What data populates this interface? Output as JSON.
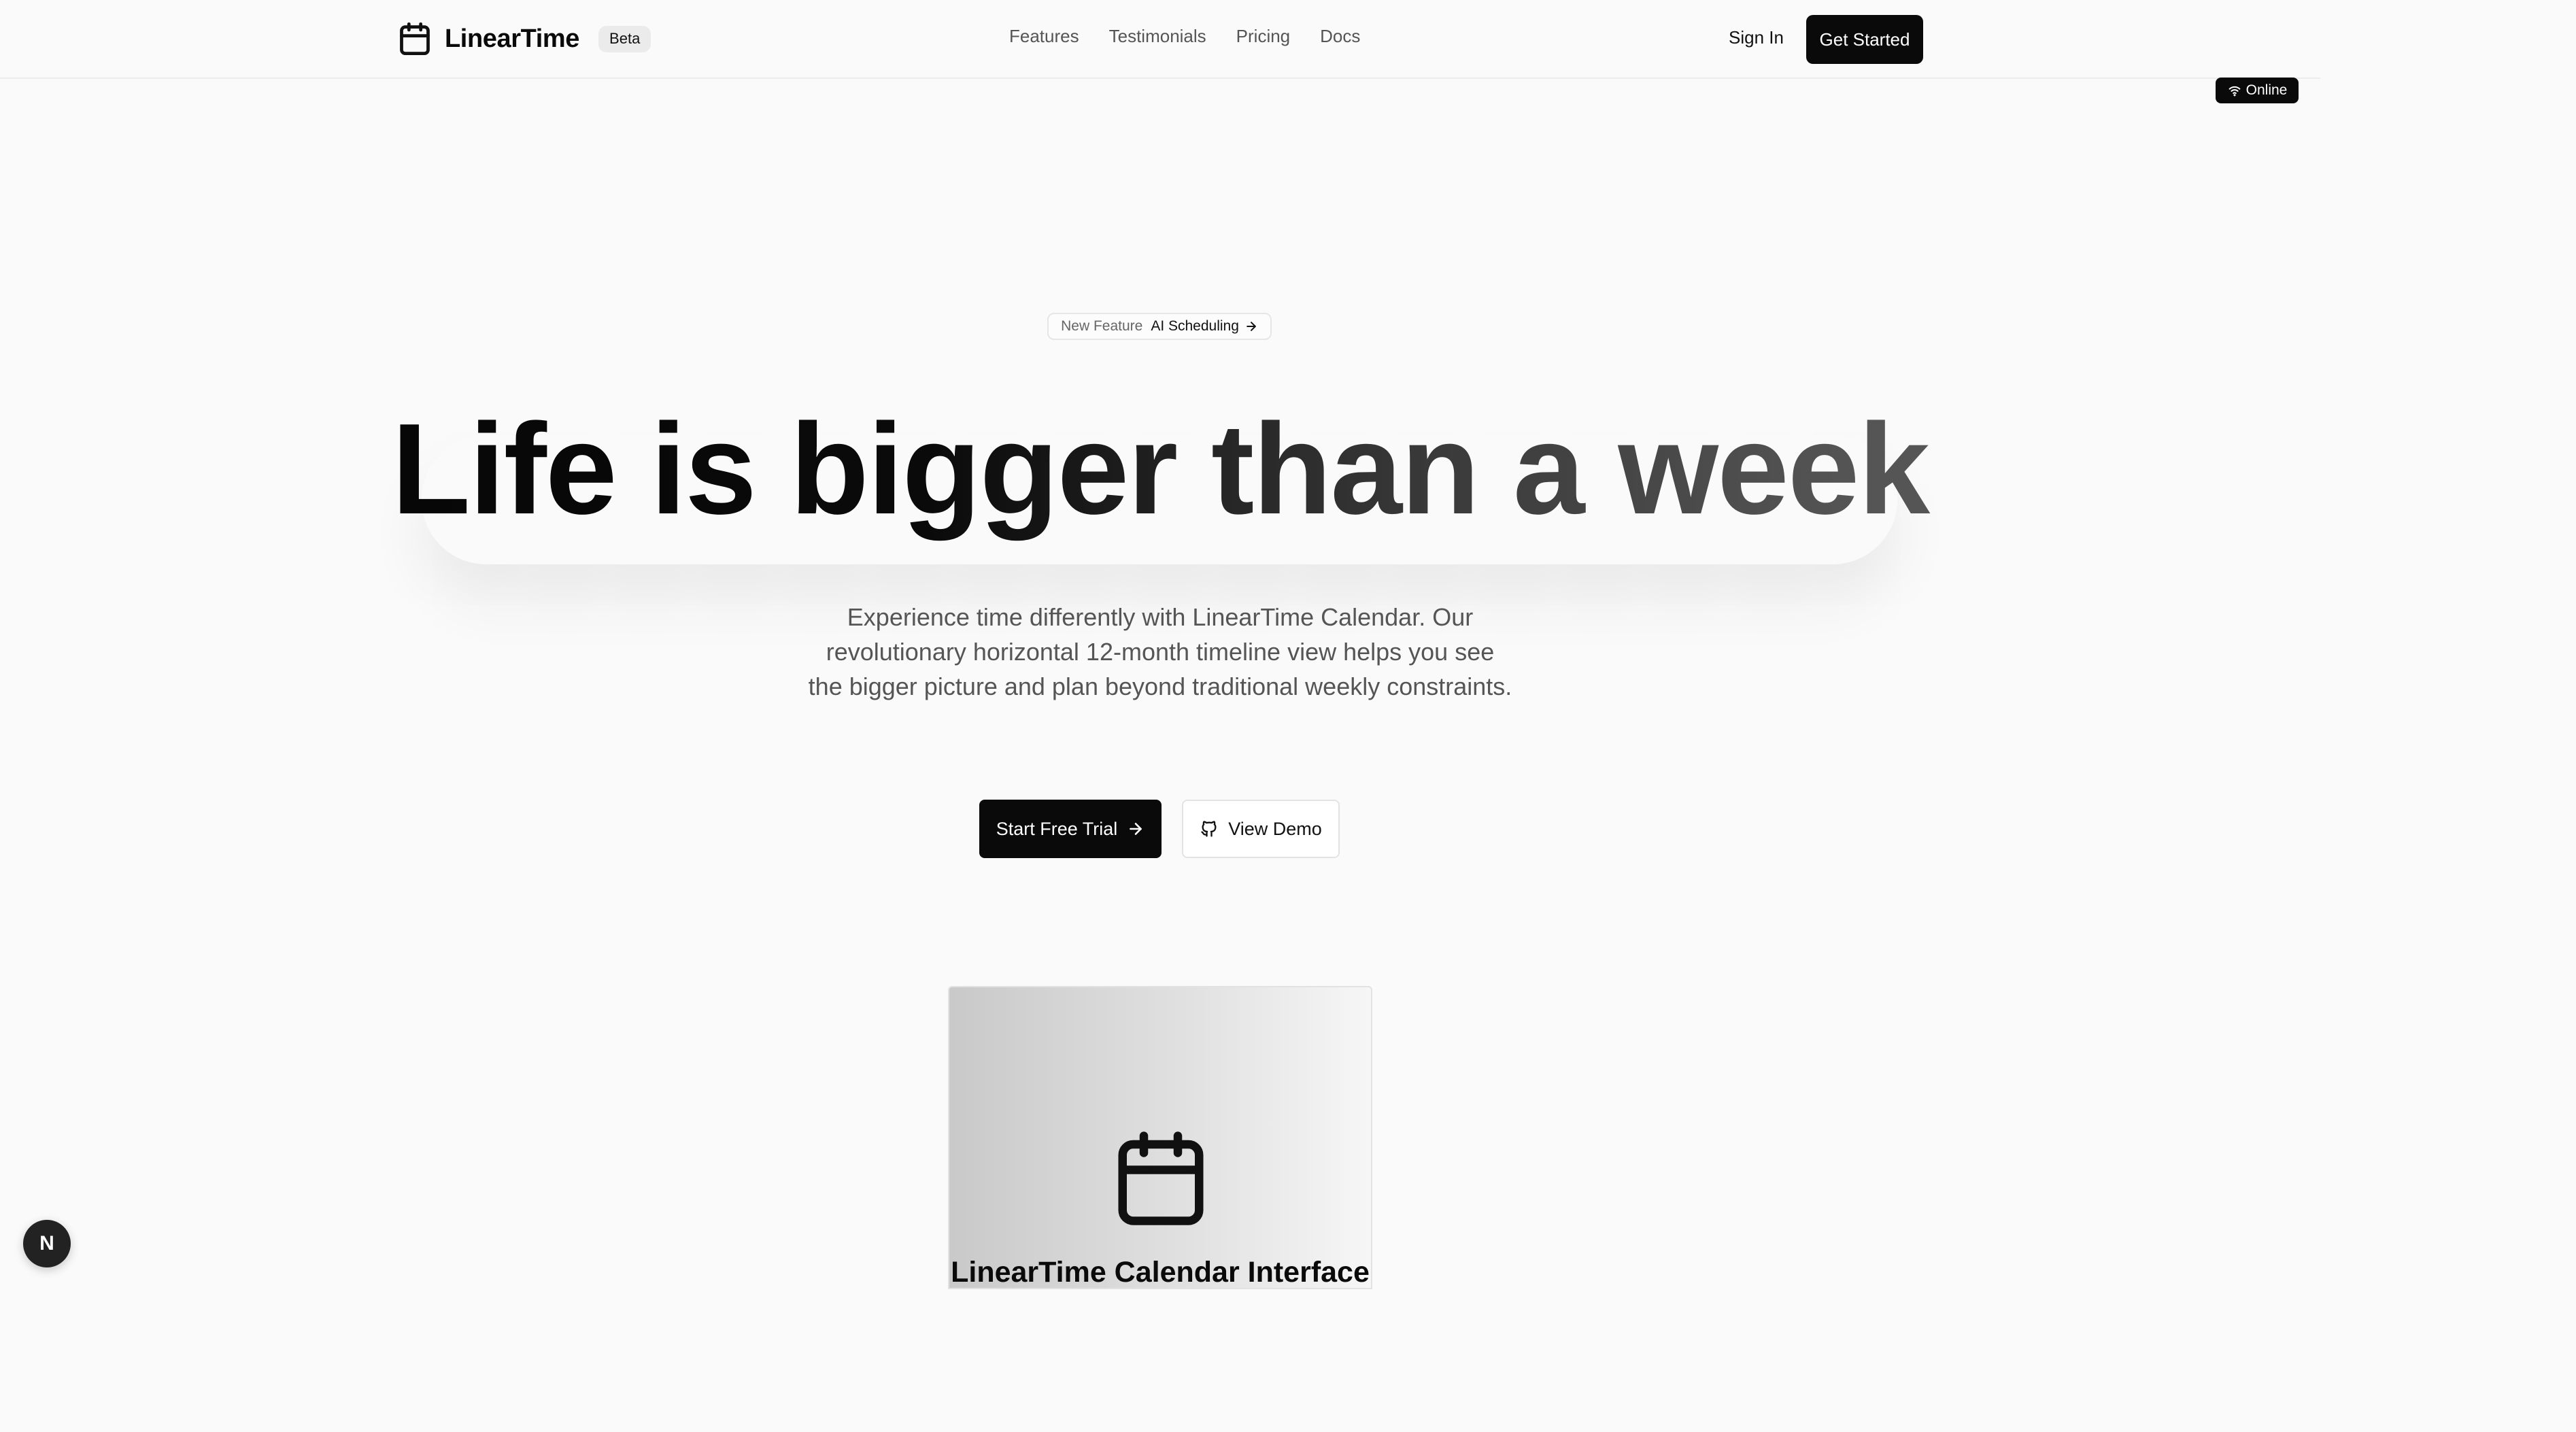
{
  "header": {
    "brand": "LinearTime",
    "beta_badge": "Beta",
    "nav": [
      "Features",
      "Testimonials",
      "Pricing",
      "Docs"
    ],
    "sign_in": "Sign In",
    "get_started": "Get Started",
    "status_badge": "Online"
  },
  "hero": {
    "pill_label": "New Feature",
    "pill_feature": "AI Scheduling",
    "headline": "Life is bigger than a week",
    "subtitle": "Experience time differently with LinearTime Calendar. Our revolutionary horizontal 12-month timeline view helps you see the bigger picture and plan beyond traditional weekly constraints.",
    "primary_cta": "Start Free Trial",
    "secondary_cta": "View Demo"
  },
  "preview": {
    "caption": "LinearTime Calendar Interface"
  },
  "dev_indicator": {
    "letter": "N"
  },
  "colors": {
    "primary": "#0a0a0a",
    "background": "#fafafa",
    "muted_text": "#555555"
  },
  "icons": {
    "brand": "calendar-icon",
    "status": "wifi-icon",
    "pill": "arrow-right-icon",
    "primary_cta": "arrow-right-icon",
    "secondary_cta": "github-icon",
    "preview": "calendar-icon"
  }
}
